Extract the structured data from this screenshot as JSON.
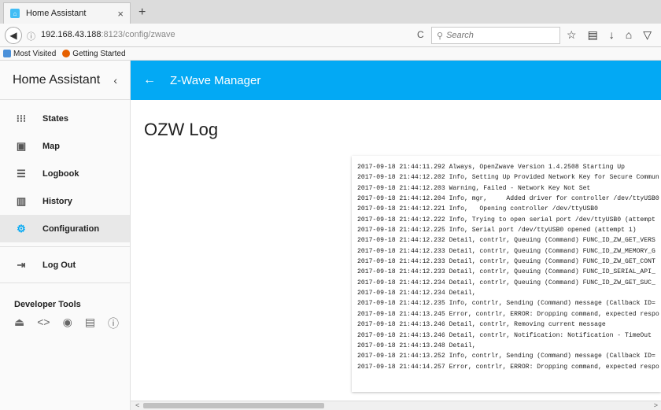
{
  "browser": {
    "tab_title": "Home Assistant",
    "tab_close": "×",
    "new_tab": "+",
    "url_host": "192.168.43.188",
    "url_rest": ":8123/config/zwave",
    "search_placeholder": "Search",
    "bookmarks": [
      "Most Visited",
      "Getting Started"
    ]
  },
  "sidebar": {
    "title": "Home Assistant",
    "items": [
      {
        "label": "States",
        "icon": "grid-icon"
      },
      {
        "label": "Map",
        "icon": "map-icon"
      },
      {
        "label": "Logbook",
        "icon": "list-icon"
      },
      {
        "label": "History",
        "icon": "chart-icon"
      },
      {
        "label": "Configuration",
        "icon": "gear-icon"
      }
    ],
    "logout_label": "Log Out",
    "dev_tools_title": "Developer Tools",
    "accent_color": "#03a9f4"
  },
  "topbar": {
    "title": "Z-Wave Manager",
    "color": "#03a9f4"
  },
  "main": {
    "page_title": "OZW Log"
  },
  "log": {
    "lines": [
      "2017-09-18 21:44:11.292 Always, OpenZwave Version 1.4.2508 Starting Up",
      "2017-09-18 21:44:12.202 Info, Setting Up Provided Network Key for Secure Commun",
      "2017-09-18 21:44:12.203 Warning, Failed - Network Key Not Set",
      "2017-09-18 21:44:12.204 Info, mgr,     Added driver for controller /dev/ttyUSB0",
      "2017-09-18 21:44:12.221 Info,   Opening controller /dev/ttyUSB0",
      "2017-09-18 21:44:12.222 Info, Trying to open serial port /dev/ttyUSB0 (attempt",
      "2017-09-18 21:44:12.225 Info, Serial port /dev/ttyUSB0 opened (attempt 1)",
      "2017-09-18 21:44:12.232 Detail, contrlr, Queuing (Command) FUNC_ID_ZW_GET_VERS",
      "2017-09-18 21:44:12.233 Detail, contrlr, Queuing (Command) FUNC_ID_ZW_MEMORY_G",
      "2017-09-18 21:44:12.233 Detail, contrlr, Queuing (Command) FUNC_ID_ZW_GET_CONT",
      "2017-09-18 21:44:12.233 Detail, contrlr, Queuing (Command) FUNC_ID_SERIAL_API_",
      "2017-09-18 21:44:12.234 Detail, contrlr, Queuing (Command) FUNC_ID_ZW_GET_SUC_",
      "2017-09-18 21:44:12.234 Detail,",
      "2017-09-18 21:44:12.235 Info, contrlr, Sending (Command) message (Callback ID=",
      "2017-09-18 21:44:13.245 Error, contrlr, ERROR: Dropping command, expected respo",
      "2017-09-18 21:44:13.246 Detail, contrlr, Removing current message",
      "2017-09-18 21:44:13.246 Detail, contrlr, Notification: Notification - TimeOut",
      "2017-09-18 21:44:13.248 Detail,",
      "2017-09-18 21:44:13.252 Info, contrlr, Sending (Command) message (Callback ID=",
      "2017-09-18 21:44:14.257 Error, contrlr, ERROR: Dropping command, expected respo"
    ]
  }
}
